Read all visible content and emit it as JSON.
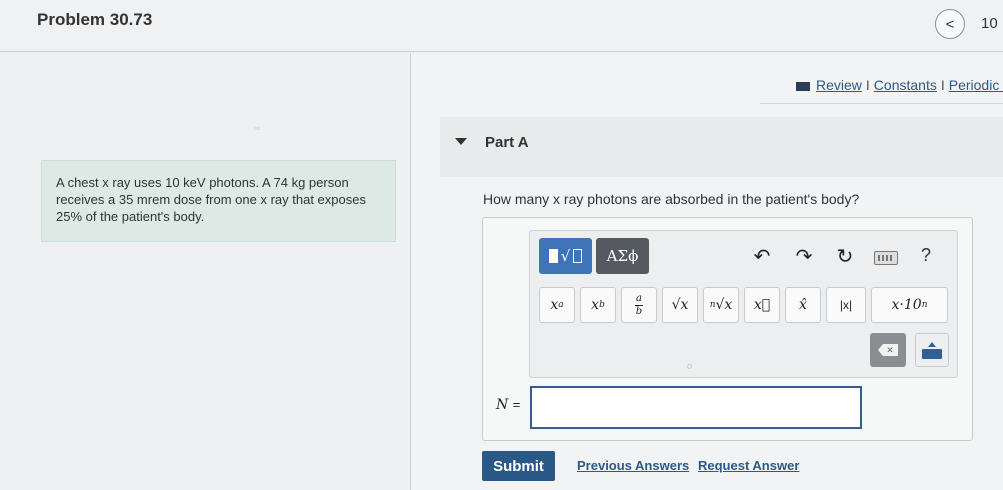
{
  "header": {
    "problem_title": "Problem 30.73",
    "nav_prev_icon": "chevron-left-icon",
    "nav_prev_glyph": "<",
    "page_count": "10"
  },
  "problem": {
    "faint_mark": "∞",
    "text": "A chest x ray uses 10 keV photons. A 74 kg person receives a 35 mrem dose from one x ray that exposes 25% of the patient's body."
  },
  "resources": {
    "review": "Review",
    "constants": "Constants",
    "periodic": "Periodic Table",
    "separator": "I"
  },
  "part": {
    "title": "Part A",
    "question": "How many x ray photons are absorbed in the patient's body?"
  },
  "toolbar": {
    "templates_glyph": "√",
    "greek_label": "ΑΣϕ",
    "undo_glyph": "↶",
    "redo_glyph": "↷",
    "reset_glyph": "↻",
    "help_glyph": "?",
    "buttons": {
      "power_base": "x",
      "power_exp": "a",
      "subscript_base": "x",
      "subscript_sub": "b",
      "frac_num": "a",
      "frac_den": "b",
      "sqrt": "√x",
      "nthroot_index": "n",
      "nthroot": "√x",
      "vector": "x⃗",
      "unit_vector": "x̂",
      "abs": "|x|",
      "sci_notation": "x·10",
      "sci_exp": "n"
    },
    "delete_glyph": "✕"
  },
  "answer": {
    "variable": "N",
    "equals": "=",
    "value": ""
  },
  "actions": {
    "submit": "Submit",
    "previous_answers": "Previous Answers",
    "request_answer": "Request Answer"
  },
  "colors": {
    "accent": "#2b5987",
    "problem_box": "#dde9e4",
    "templates_button": "#3f74b8",
    "greek_button": "#555a60"
  }
}
